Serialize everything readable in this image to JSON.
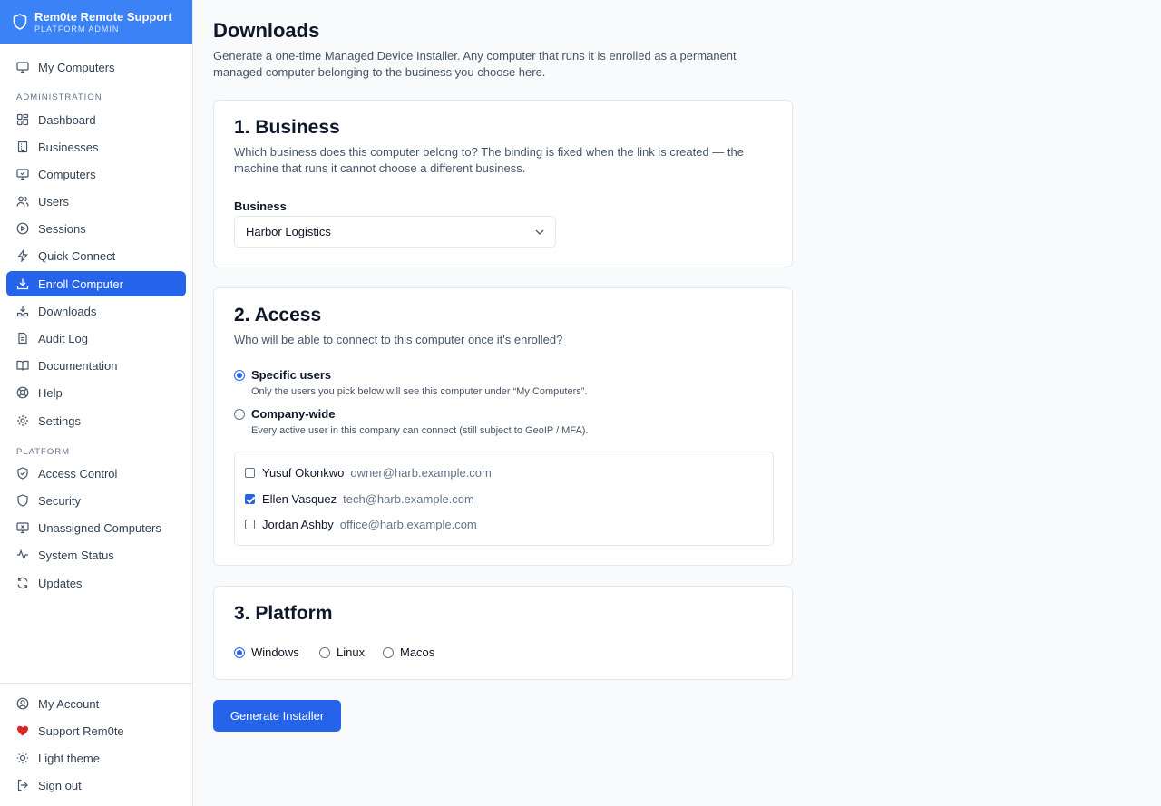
{
  "brand": {
    "title": "Rem0te Remote Support",
    "subtitle": "PLATFORM ADMIN"
  },
  "sidebar": {
    "top_item": "My Computers",
    "section_admin": "ADMINISTRATION",
    "admin_items": [
      "Dashboard",
      "Businesses",
      "Computers",
      "Users",
      "Sessions",
      "Quick Connect",
      "Enroll Computer",
      "Downloads",
      "Audit Log",
      "Documentation",
      "Help",
      "Settings"
    ],
    "active_item": "Enroll Computer",
    "section_platform": "PLATFORM",
    "platform_items": [
      "Access Control",
      "Security",
      "Unassigned Computers",
      "System Status",
      "Updates"
    ],
    "bottom_items": [
      "My Account",
      "Support Rem0te",
      "Light theme",
      "Sign out"
    ]
  },
  "page": {
    "title": "Downloads",
    "description": "Generate a one-time Managed Device Installer. Any computer that runs it is enrolled as a permanent managed computer belonging to the business you choose here."
  },
  "business_card": {
    "title": "1. Business",
    "description": "Which business does this computer belong to? The binding is fixed when the link is created — the machine that runs it cannot choose a different business.",
    "field_label": "Business",
    "selected": "Harbor Logistics"
  },
  "access_card": {
    "title": "2. Access",
    "description": "Who will be able to connect to this computer once it's enrolled?",
    "options": [
      {
        "label": "Specific users",
        "help": "Only the users you pick below will see this computer under “My Computers”.",
        "checked": true
      },
      {
        "label": "Company-wide",
        "help": "Every active user in this company can connect (still subject to GeoIP / MFA).",
        "checked": false
      }
    ],
    "users": [
      {
        "name": "Yusuf Okonkwo",
        "email": "owner@harb.example.com",
        "checked": false
      },
      {
        "name": "Ellen Vasquez",
        "email": "tech@harb.example.com",
        "checked": true
      },
      {
        "name": "Jordan Ashby",
        "email": "office@harb.example.com",
        "checked": false
      }
    ]
  },
  "platform_card": {
    "title": "3. Platform",
    "options": [
      {
        "label": "Windows",
        "checked": true
      },
      {
        "label": "Linux",
        "checked": false
      },
      {
        "label": "Macos",
        "checked": false
      }
    ]
  },
  "actions": {
    "generate": "Generate Installer"
  },
  "colors": {
    "accent": "#2563eb",
    "brand_bar": "#3b82f6",
    "heart": "#dc2626"
  }
}
